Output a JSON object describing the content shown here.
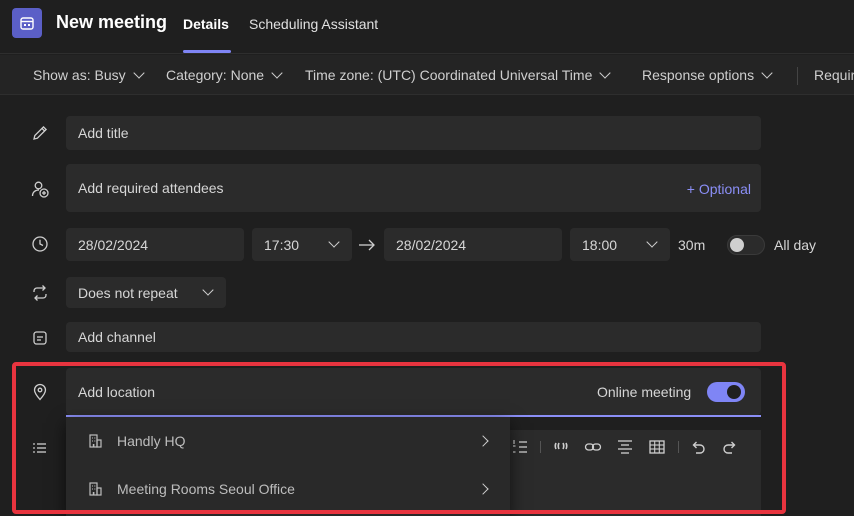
{
  "header": {
    "title": "New meeting",
    "tabs": [
      {
        "label": "Details",
        "active": true
      },
      {
        "label": "Scheduling Assistant",
        "active": false
      }
    ]
  },
  "toolbar": {
    "show_as": "Show as: Busy",
    "category": "Category: None",
    "time_zone": "Time zone:  (UTC) Coordinated Universal Time",
    "response_options": "Response options",
    "require": "Requir"
  },
  "form": {
    "title_placeholder": "Add title",
    "attendees_placeholder": "Add required attendees",
    "optional_label": "+ Optional",
    "start_date": "28/02/2024",
    "start_time": "17:30",
    "end_date": "28/02/2024",
    "end_time": "18:00",
    "duration": "30m",
    "all_day_label": "All day",
    "all_day_on": false,
    "repeat": "Does not repeat",
    "channel_placeholder": "Add channel",
    "location_placeholder": "Add location",
    "online_meeting_label": "Online meeting",
    "online_meeting_on": true
  },
  "location_suggestions": [
    {
      "label": "Handly HQ",
      "icon": "building-icon"
    },
    {
      "label": "Meeting Rooms Seoul Office",
      "icon": "building-icon"
    }
  ],
  "colors": {
    "accent": "#7f85f5",
    "highlight": "#e8343f",
    "app_icon": "#5b5fc7"
  }
}
